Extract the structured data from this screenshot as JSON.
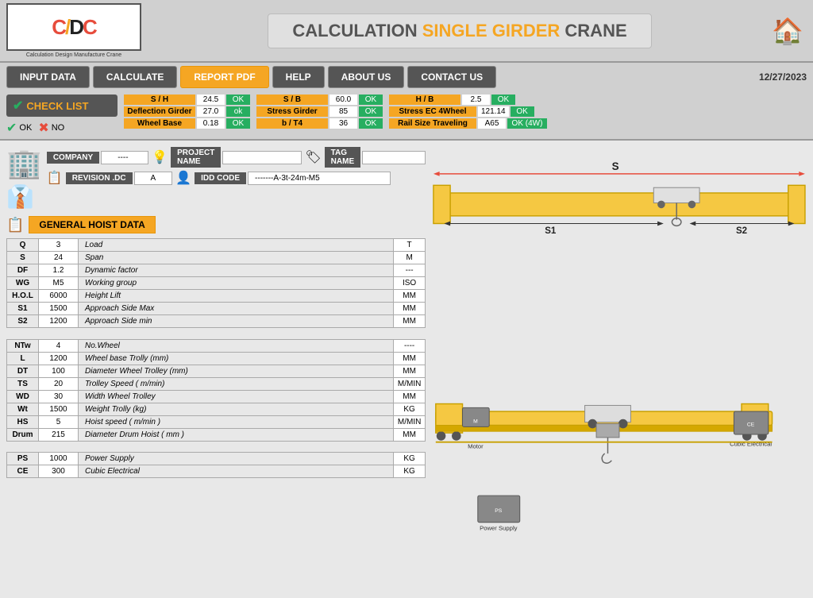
{
  "header": {
    "logo_text": "CDC",
    "logo_sub": "Calculation Design Manufacture Crane",
    "main_title": "CALCULATION ",
    "title_highlight": "SINGLE GIRDER",
    "title_end": " CRANE",
    "date": "12/27/2023"
  },
  "navbar": {
    "buttons": [
      {
        "label": "INPUT DATA",
        "id": "input-data"
      },
      {
        "label": "CALCULATE",
        "id": "calculate"
      },
      {
        "label": "REPORT PDF",
        "id": "report-pdf",
        "active": true
      },
      {
        "label": "HELP",
        "id": "help"
      },
      {
        "label": "ABOUT US",
        "id": "about-us"
      },
      {
        "label": "CONTACT US",
        "id": "contact-us"
      }
    ]
  },
  "checklist": {
    "title": "CHECK LIST",
    "ok_label": "OK",
    "no_label": "NO",
    "checks": [
      [
        {
          "label": "S / H",
          "value": "24.5",
          "status": "OK"
        },
        {
          "label": "Deflection Girder",
          "value": "27.0",
          "status": "ok"
        },
        {
          "label": "Wheel Base",
          "value": "0.18",
          "status": "OK"
        }
      ],
      [
        {
          "label": "S / B",
          "value": "60.0",
          "status": "OK"
        },
        {
          "label": "Stress Girder",
          "value": "85",
          "status": "OK"
        },
        {
          "label": "b / T4",
          "value": "36",
          "status": "OK"
        }
      ],
      [
        {
          "label": "H / B",
          "value": "2.5",
          "status": "OK"
        },
        {
          "label": "Stress EC  4Wheel",
          "value": "121.14",
          "status": "OK"
        },
        {
          "label": "Rail Size Traveling",
          "value": "A65",
          "status": "OK (4W)"
        }
      ]
    ]
  },
  "info": {
    "company_label": "COMPANY",
    "company_value": "----",
    "project_label": "PROJECT NAME",
    "project_value": "",
    "tag_label": "TAG NAME",
    "tag_value": "",
    "revision_label": "REVISION .DC",
    "revision_value": "A",
    "idd_label": "IDD CODE",
    "idd_value": "-------A-3t-24m-M5"
  },
  "general_hoist": {
    "title": "GENERAL HOIST DATA",
    "rows": [
      {
        "key": "Q",
        "value": "3",
        "label": "Load",
        "unit": "T"
      },
      {
        "key": "S",
        "value": "24",
        "label": "Span",
        "unit": "M"
      },
      {
        "key": "DF",
        "value": "1.2",
        "label": "Dynamic factor",
        "unit": "---"
      },
      {
        "key": "WG",
        "value": "M5",
        "label": "Working group",
        "unit": "ISO"
      },
      {
        "key": "H.O.L",
        "value": "6000",
        "label": "Height Lift",
        "unit": "MM"
      },
      {
        "key": "S1",
        "value": "1500",
        "label": "Approach Side Max",
        "unit": "MM"
      },
      {
        "key": "S2",
        "value": "1200",
        "label": "Approach Side min",
        "unit": "MM"
      }
    ]
  },
  "trolley_data": {
    "rows": [
      {
        "key": "NTw",
        "value": "4",
        "label": "No.Wheel",
        "unit": "----"
      },
      {
        "key": "L",
        "value": "1200",
        "label": "Wheel base Trolly (mm)",
        "unit": "MM"
      },
      {
        "key": "DT",
        "value": "100",
        "label": "Diameter Wheel Trolley (mm)",
        "unit": "MM"
      },
      {
        "key": "TS",
        "value": "20",
        "label": "Trolley Speed ( m/min)",
        "unit": "M/MIN"
      },
      {
        "key": "WD",
        "value": "30",
        "label": "Width Wheel Trolley",
        "unit": "MM"
      },
      {
        "key": "Wt",
        "value": "1500",
        "label": "Weight Trolly (kg)",
        "unit": "KG"
      },
      {
        "key": "HS",
        "value": "5",
        "label": "Hoist speed ( m/min )",
        "unit": "M/MIN"
      },
      {
        "key": "Drum",
        "value": "215",
        "label": "Diameter Drum Hoist ( mm )",
        "unit": "MM"
      }
    ]
  },
  "power_data": {
    "rows": [
      {
        "key": "PS",
        "value": "1000",
        "label": "Power Supply",
        "unit": "KG"
      },
      {
        "key": "CE",
        "value": "300",
        "label": "Cubic Electrical",
        "unit": "KG"
      }
    ]
  },
  "diagram": {
    "s_label": "S",
    "s1_label": "S1",
    "s2_label": "S2",
    "motor_label": "Motor",
    "power_supply_label": "Power Supply",
    "cubic_electrical_label": "Cubic Electrical"
  }
}
